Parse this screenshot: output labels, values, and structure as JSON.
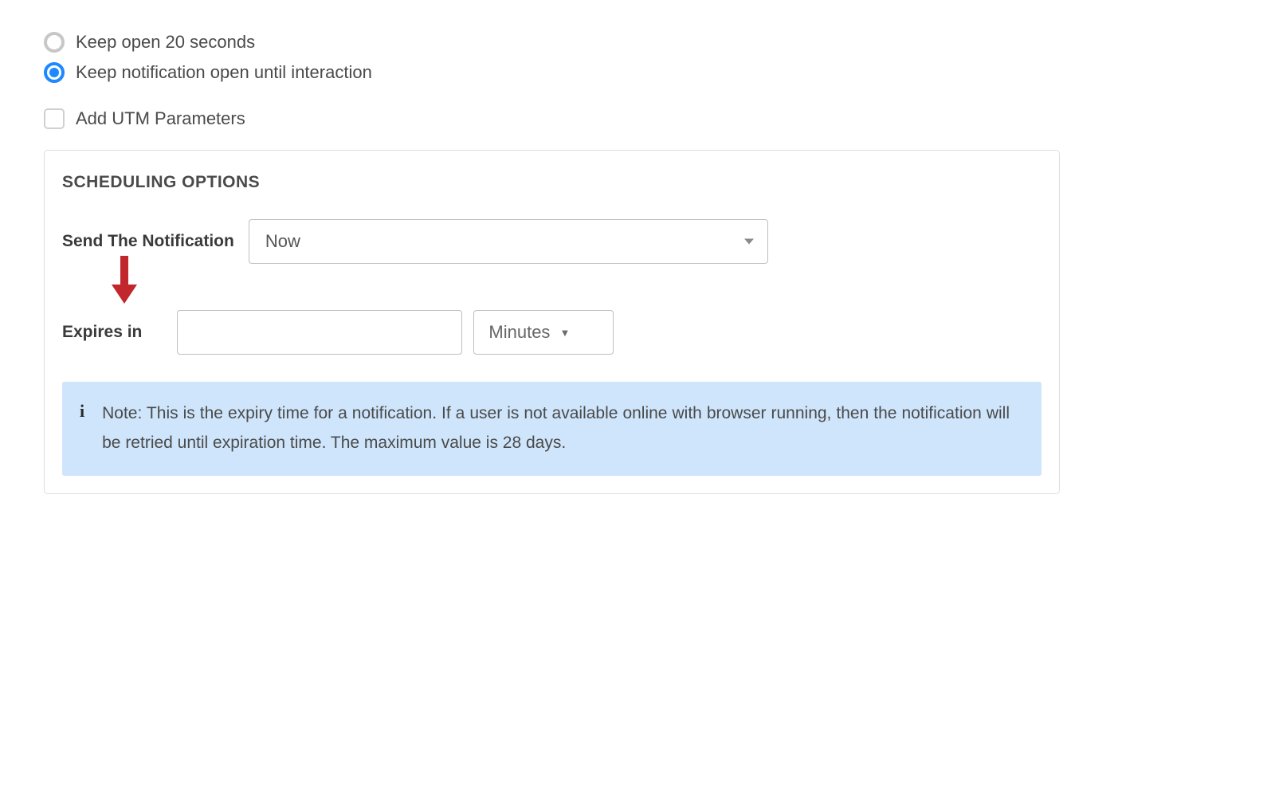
{
  "radios": {
    "option1_label": "Keep open 20 seconds",
    "option2_label": "Keep notification open until interaction",
    "selected_index": 1
  },
  "checkbox": {
    "utm_label": "Add UTM Parameters",
    "checked": false
  },
  "panel": {
    "title": "SCHEDULING OPTIONS",
    "send_label": "Send The Notification",
    "send_select_value": "Now",
    "expires_label": "Expires in",
    "expires_value": "",
    "expires_unit_value": "Minutes",
    "note_text": "Note: This is the expiry time for a notification. If a user is not available online with browser running, then the notification will be retried until expiration time. The maximum value is 28 days."
  },
  "annotation": {
    "arrow_color": "#c1272d"
  }
}
